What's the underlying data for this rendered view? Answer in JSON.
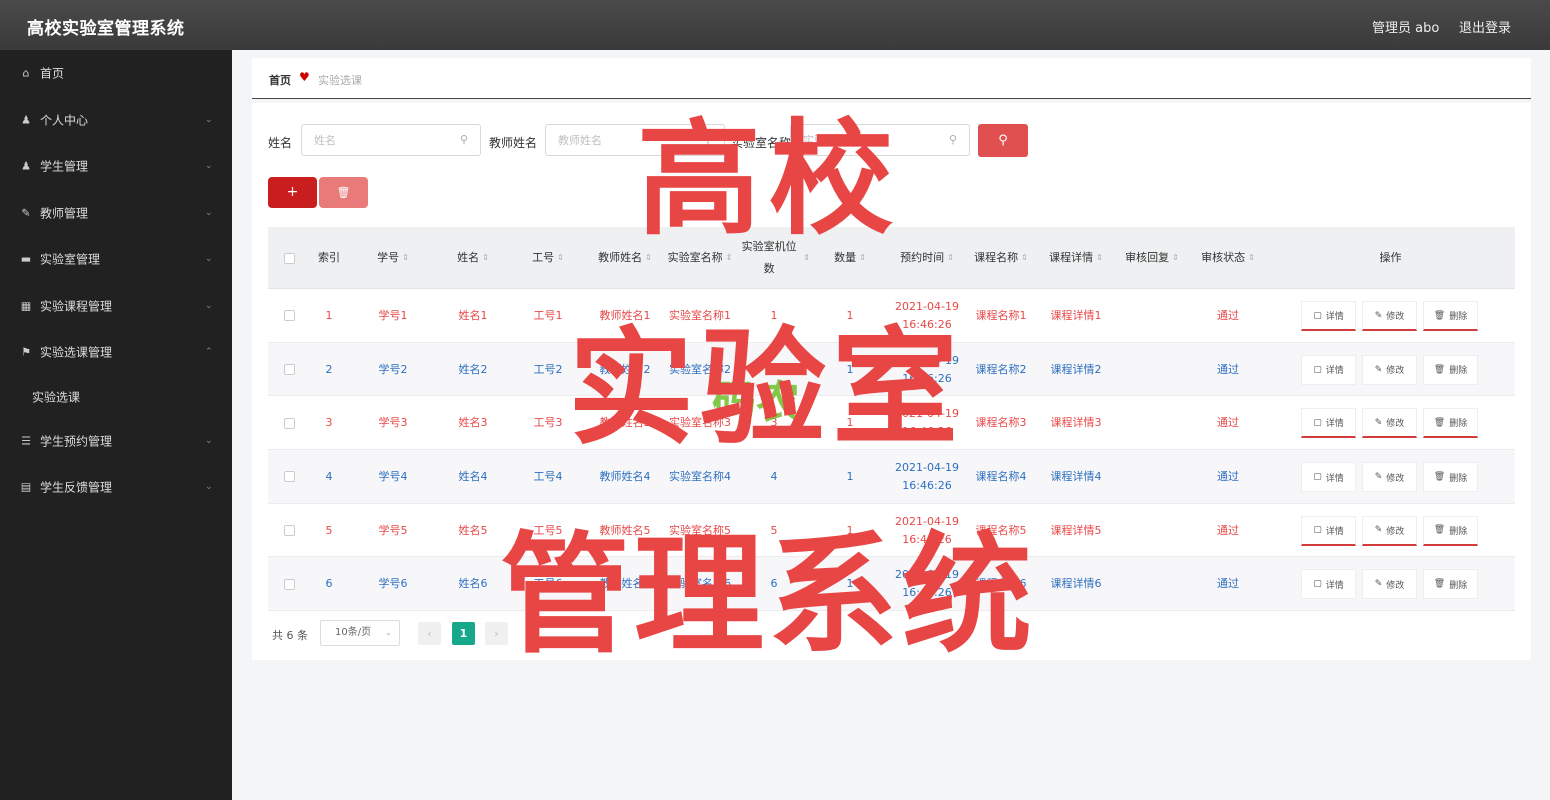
{
  "app": {
    "title": "高校实验室管理系统",
    "user": "管理员 abo",
    "logout": "退出登录"
  },
  "sidebar": {
    "items": [
      {
        "label": "首页",
        "icon": "home-icon",
        "glyph": "⌂",
        "arrow": ""
      },
      {
        "label": "个人中心",
        "icon": "user-icon",
        "glyph": "♟",
        "arrow": "⌄"
      },
      {
        "label": "学生管理",
        "icon": "user-icon",
        "glyph": "♟",
        "arrow": "⌄"
      },
      {
        "label": "教师管理",
        "icon": "teacher-icon",
        "glyph": "✎",
        "arrow": "⌄"
      },
      {
        "label": "实验室管理",
        "icon": "monitor-icon",
        "glyph": "▬",
        "arrow": "⌄"
      },
      {
        "label": "实验课程管理",
        "icon": "chart-icon",
        "glyph": "▦",
        "arrow": "⌄"
      },
      {
        "label": "实验选课管理",
        "icon": "flag-icon",
        "glyph": "⚑",
        "arrow": "⌃"
      },
      {
        "label": "学生预约管理",
        "icon": "list-icon",
        "glyph": "☰",
        "arrow": "⌄"
      },
      {
        "label": "学生反馈管理",
        "icon": "clipboard-icon",
        "glyph": "▤",
        "arrow": "⌄"
      }
    ],
    "sub_item": "实验选课"
  },
  "breadcrumb": {
    "home": "首页",
    "current": "实验选课"
  },
  "search": {
    "name_label": "姓名",
    "name_placeholder": "姓名",
    "teacher_label": "教师姓名",
    "teacher_placeholder": "教师姓名",
    "lab_label": "实验室名称",
    "lab_placeholder": "实验室名称",
    "search_glyph": "⚲"
  },
  "actions": {
    "add": "+",
    "delete": "🗑"
  },
  "table": {
    "headers": [
      "索引",
      "学号",
      "姓名",
      "工号",
      "教师姓名",
      "实验室名称",
      "实验室机位数",
      "数量",
      "预约时间",
      "课程名称",
      "课程详情",
      "审核回复",
      "审核状态",
      "操作"
    ],
    "rows": [
      {
        "idx": "1",
        "xh": "学号1",
        "xm": "姓名1",
        "gh": "工号1",
        "jsxm": "教师姓名1",
        "sysmc": "实验室名称1",
        "jws": "1",
        "sl": "1",
        "yysj": "2021-04-19 16:46:26",
        "kcmc": "课程名称1",
        "kcxq": "课程详情1",
        "shhf": "",
        "shzt": "通过"
      },
      {
        "idx": "2",
        "xh": "学号2",
        "xm": "姓名2",
        "gh": "工号2",
        "jsxm": "教师姓名2",
        "sysmc": "实验室名称2",
        "jws": "2",
        "sl": "1",
        "yysj": "2021-04-19 16:46:26",
        "kcmc": "课程名称2",
        "kcxq": "课程详情2",
        "shhf": "",
        "shzt": "通过"
      },
      {
        "idx": "3",
        "xh": "学号3",
        "xm": "姓名3",
        "gh": "工号3",
        "jsxm": "教师姓名3",
        "sysmc": "实验室名称3",
        "jws": "3",
        "sl": "1",
        "yysj": "2021-04-19 16:46:26",
        "kcmc": "课程名称3",
        "kcxq": "课程详情3",
        "shhf": "",
        "shzt": "通过"
      },
      {
        "idx": "4",
        "xh": "学号4",
        "xm": "姓名4",
        "gh": "工号4",
        "jsxm": "教师姓名4",
        "sysmc": "实验室名称4",
        "jws": "4",
        "sl": "1",
        "yysj": "2021-04-19 16:46:26",
        "kcmc": "课程名称4",
        "kcxq": "课程详情4",
        "shhf": "",
        "shzt": "通过"
      },
      {
        "idx": "5",
        "xh": "学号5",
        "xm": "姓名5",
        "gh": "工号5",
        "jsxm": "教师姓名5",
        "sysmc": "实验室名称5",
        "jws": "5",
        "sl": "1",
        "yysj": "2021-04-19 16:46:26",
        "kcmc": "课程名称5",
        "kcxq": "课程详情5",
        "shhf": "",
        "shzt": "通过"
      },
      {
        "idx": "6",
        "xh": "学号6",
        "xm": "姓名6",
        "gh": "工号6",
        "jsxm": "教师姓名6",
        "sysmc": "实验室名称6",
        "jws": "6",
        "sl": "1",
        "yysj": "2021-04-19 16:46:26",
        "kcmc": "课程名称6",
        "kcxq": "课程详情6",
        "shhf": "",
        "shzt": "通过"
      }
    ],
    "ops": [
      "详情",
      "修改",
      "删除"
    ]
  },
  "pagination": {
    "total": "共 6 条",
    "page_size": "10条/页",
    "current": "1",
    "prev": "‹",
    "next": "›"
  },
  "overlay": {
    "line1": "高校",
    "line2": "实验室",
    "line3": "管理系统",
    "logo": "码农"
  },
  "colors": {
    "accent_red": "#e84545",
    "row_link_blue": "#2e6fc0",
    "pager_green": "#17a78a",
    "sidebar_bg": "#212121"
  }
}
